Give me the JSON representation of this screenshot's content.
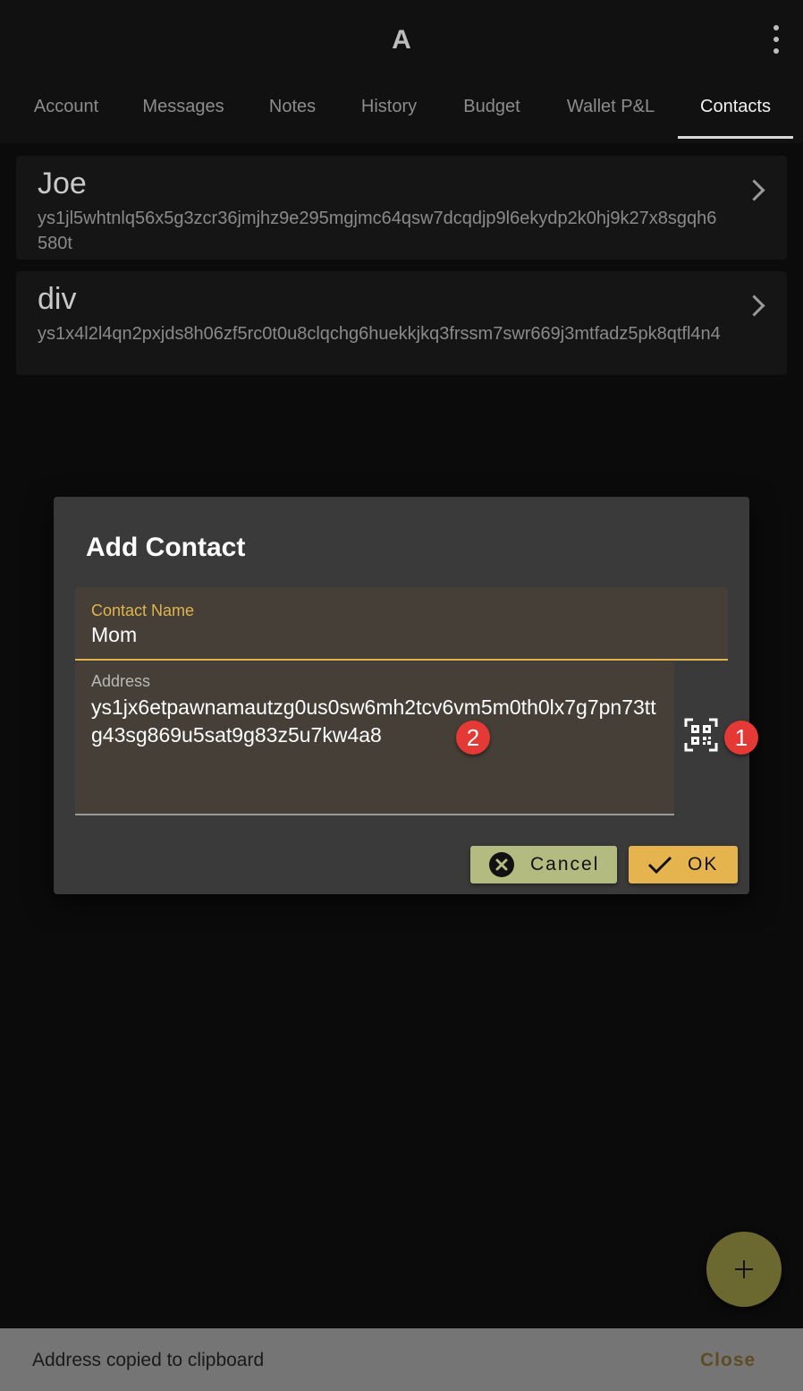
{
  "app": {
    "title": "A"
  },
  "tabs": [
    "Account",
    "Messages",
    "Notes",
    "History",
    "Budget",
    "Wallet P&L",
    "Contacts"
  ],
  "active_tab": "Contacts",
  "contacts": [
    {
      "name": "Joe",
      "address": "ys1jl5whtnlq56x5g3zcr36jmjhz9e295mgjmc64qsw7dcqdjp9l6ekydp2k0hj9k27x8sgqh6580t"
    },
    {
      "name": "div",
      "address": "ys1x4l2l4qn2pxjds8h06zf5rc0t0u8clqchg6huekkjkq3frssm7swr669j3mtfadz5pk8qtfl4n4"
    }
  ],
  "dialog": {
    "title": "Add Contact",
    "name_label": "Contact Name",
    "name_value": "Mom",
    "address_label": "Address",
    "address_value": "ys1jx6etpawnamautzg0us0sw6mh2tcv6vm5m0th0lx7g7pn73ttg43sg869u5sat9g83z5u7kw4a8",
    "cancel_label": "Cancel",
    "ok_label": "OK"
  },
  "badges": [
    "1",
    "2"
  ],
  "fab_icon": "plus-icon",
  "snackbar": {
    "text": "Address copied to clipboard",
    "action": "Close"
  },
  "colors": {
    "background": "#0b0b0b",
    "dialog": "#3a3a3a",
    "accent": "#e0b450",
    "cancel_button": "#b3bb80",
    "ok_button": "#e5b44f",
    "badge": "#e53935"
  }
}
